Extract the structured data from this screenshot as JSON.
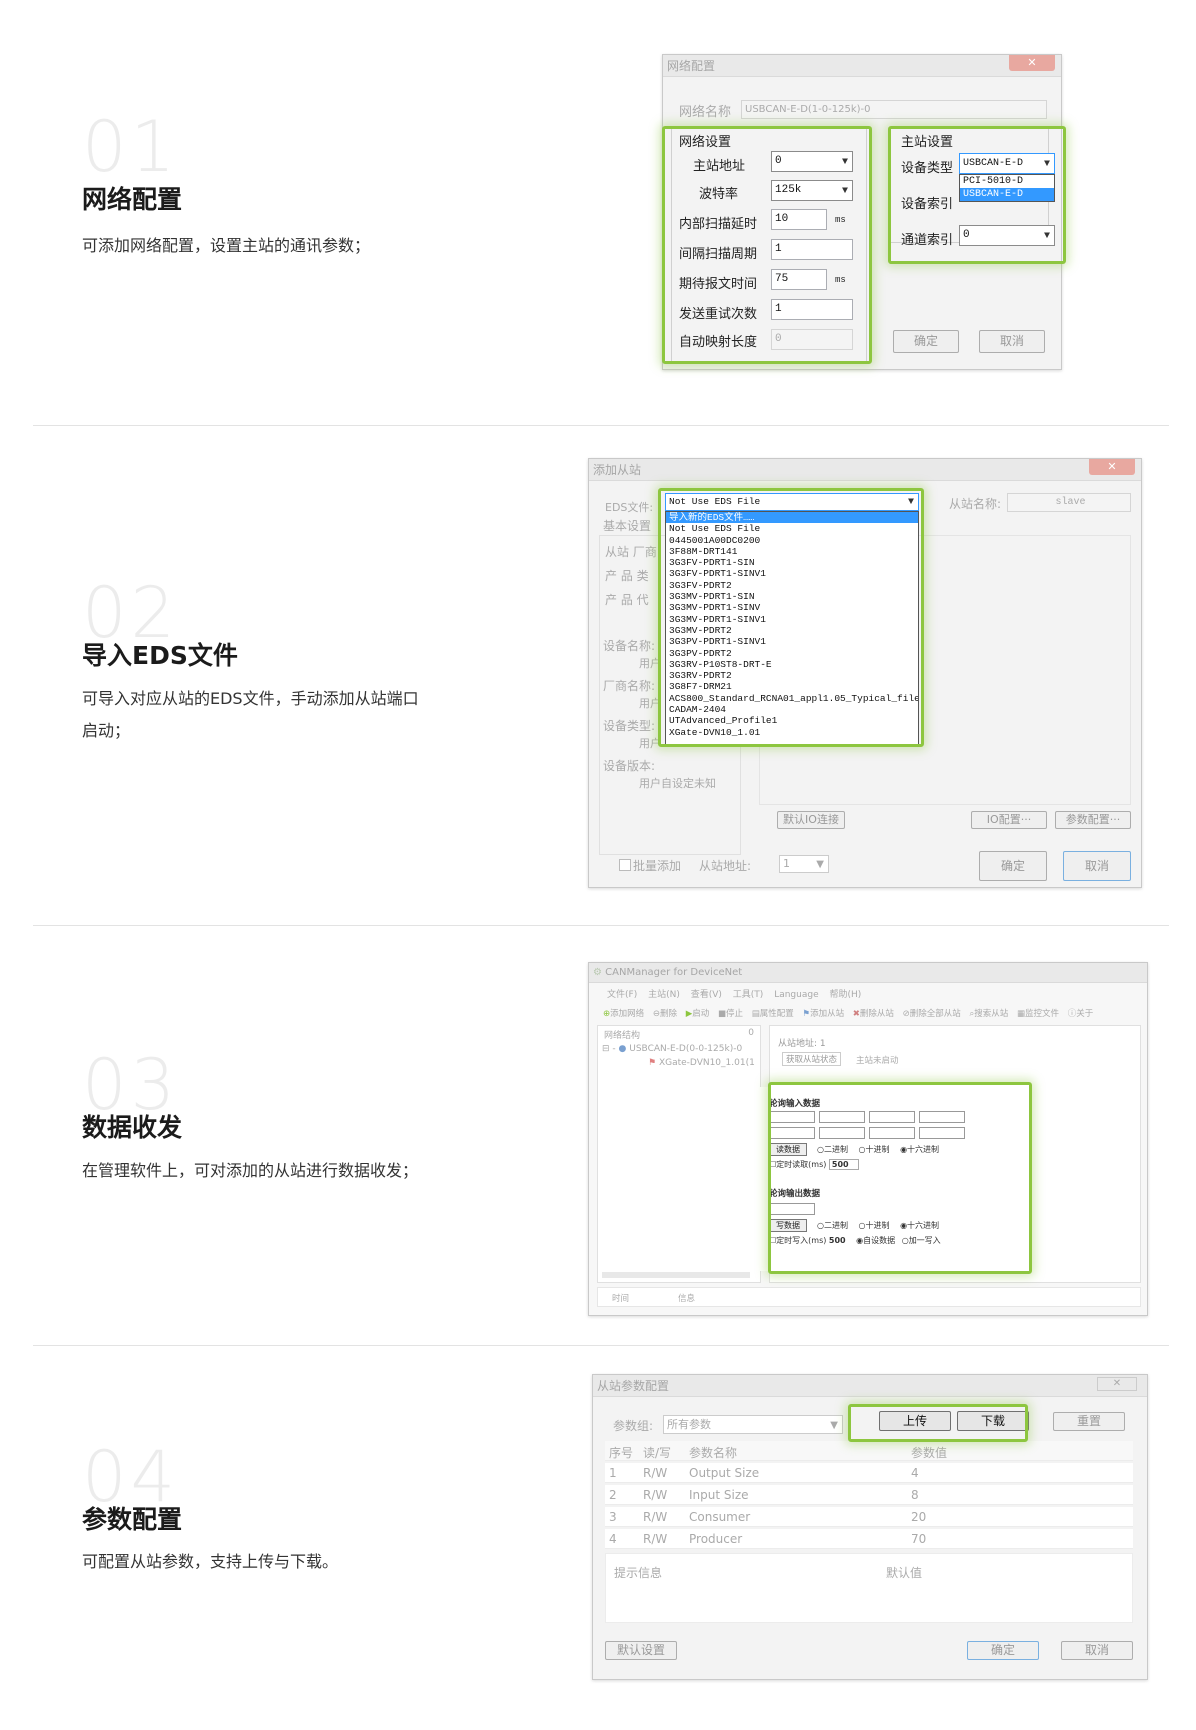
{
  "sections": [
    {
      "num": "01",
      "title": "网络配置",
      "desc": "可添加网络配置，设置主站的通讯参数；"
    },
    {
      "num": "02",
      "title": "导入EDS文件",
      "desc": "可导入对应从站的EDS文件，手动添加从站端口启动；"
    },
    {
      "num": "03",
      "title": "数据收发",
      "desc": "在管理软件上，可对添加的从站进行数据收发；"
    },
    {
      "num": "04",
      "title": "参数配置",
      "desc": "可配置从站参数，支持上传与下载。"
    }
  ],
  "win1": {
    "title": "网络配置",
    "net_name_label": "网络名称",
    "net_name_value": "USBCAN-E-D(1-0-125k)-0",
    "net_group": "网络设置",
    "rows": [
      {
        "label": "主站地址",
        "value": "0",
        "unit": ""
      },
      {
        "label": "波特率",
        "value": "125k",
        "unit": ""
      },
      {
        "label": "内部扫描延时",
        "value": "10",
        "unit": "ms"
      },
      {
        "label": "间隔扫描周期",
        "value": "1",
        "unit": ""
      },
      {
        "label": "期待报文时间",
        "value": "75",
        "unit": "ms"
      },
      {
        "label": "发送重试次数",
        "value": "1",
        "unit": ""
      },
      {
        "label": "自动映射长度",
        "value": "0",
        "unit": ""
      }
    ],
    "master_group": "主站设置",
    "device_type_label": "设备类型",
    "device_type_value": "USBCAN-E-D",
    "device_type_options": [
      "PCI-5010-D",
      "USBCAN-E-D"
    ],
    "device_index_label": "设备索引",
    "channel_index_label": "通道索引",
    "channel_index_value": "0",
    "ok": "确定",
    "cancel": "取消"
  },
  "win2": {
    "title": "添加从站",
    "eds_label": "EDS文件:",
    "eds_value": "Not Use EDS File",
    "slave_name_label": "从站名称:",
    "slave_name_value": "slave",
    "basic_label": "基本设置",
    "vendor_label": "从站 厂商",
    "product_type_label": "产 品 类",
    "product_code_label": "产 品 代",
    "device_name_label": "设备名称:",
    "vendor_name_label": "厂商名称:",
    "device_type_label": "设备类型:",
    "device_version_label": "设备版本:",
    "user_defined": "用户",
    "user_defined_unknown": "用户自设定未知",
    "eds_options": [
      "导入新的EDS文件……",
      "Not Use EDS File",
      "0445001A00DC0200",
      "3F88M-DRT141",
      "3G3FV-PDRT1-SIN",
      "3G3FV-PDRT1-SINV1",
      "3G3FV-PDRT2",
      "3G3MV-PDRT1-SIN",
      "3G3MV-PDRT1-SINV",
      "3G3MV-PDRT1-SINV1",
      "3G3MV-PDRT2",
      "3G3PV-PDRT1-SINV1",
      "3G3PV-PDRT2",
      "3G3RV-P10ST8-DRT-E",
      "3G3RV-PDRT2",
      "3G8F7-DRM21",
      "ACS800_Standard_RCNA01_appl1.05_Typical_file",
      "CADAM-2404",
      "UTAdvanced_Profile1",
      "XGate-DVN10_1.01"
    ],
    "default_io": "默认IO连接",
    "io_config": "IO配置···",
    "param_config": "参数配置···",
    "batch_add": "批量添加",
    "slave_addr_label": "从站地址:",
    "slave_addr_value": "1",
    "ok": "确定",
    "cancel": "取消"
  },
  "win3": {
    "title": "CANManager for DeviceNet",
    "menu": [
      "文件(F)",
      "主站(N)",
      "查看(V)",
      "工具(T)",
      "Language",
      "帮助(H)"
    ],
    "toolbar": [
      "添加网络",
      "删除",
      "启动",
      "停止",
      "属性配置",
      "添加从站",
      "删除从站",
      "删除全部从站",
      "搜索从站",
      "监控文件",
      "关于"
    ],
    "tree_header": "网络结构",
    "tree_header_num": "0",
    "tree_net": "USBCAN-E-D(0-0-125k)-0",
    "tree_slave": "XGate-DVN10_1.01(1",
    "slave_addr": "从站地址: 1",
    "get_status": "获取从站状态",
    "master_status": "主站未启动",
    "poll_in": "轮询输入数据",
    "read_btn": "读数据",
    "bin": "二进制",
    "dec": "十进制",
    "hex": "十六进制",
    "timed_read": "定时读取",
    "ms_unit": "(ms)",
    "read_period": "500",
    "poll_out": "轮询输出数据",
    "write_btn": "写数据",
    "timed_write": "定时写入",
    "write_period": "500",
    "auto_data": "自设数据",
    "add_one": "加一写入",
    "log_time": "时间",
    "log_info": "信息"
  },
  "win4": {
    "title": "从站参数配置",
    "param_group_label": "参数组:",
    "param_group_value": "所有参数",
    "upload": "上传",
    "download": "下载",
    "reset": "重置",
    "cols": [
      "序号",
      "读/写",
      "参数名称",
      "参数值"
    ],
    "rows": [
      {
        "no": "1",
        "rw": "R/W",
        "name": "Output Size",
        "value": "4"
      },
      {
        "no": "2",
        "rw": "R/W",
        "name": "Input Size",
        "value": "8"
      },
      {
        "no": "3",
        "rw": "R/W",
        "name": "Consumer",
        "value": "20"
      },
      {
        "no": "4",
        "rw": "R/W",
        "name": "Producer",
        "value": "70"
      }
    ],
    "hint": "提示信息",
    "default_val": "默认值",
    "default_set": "默认设置",
    "ok": "确定",
    "cancel": "取消"
  }
}
